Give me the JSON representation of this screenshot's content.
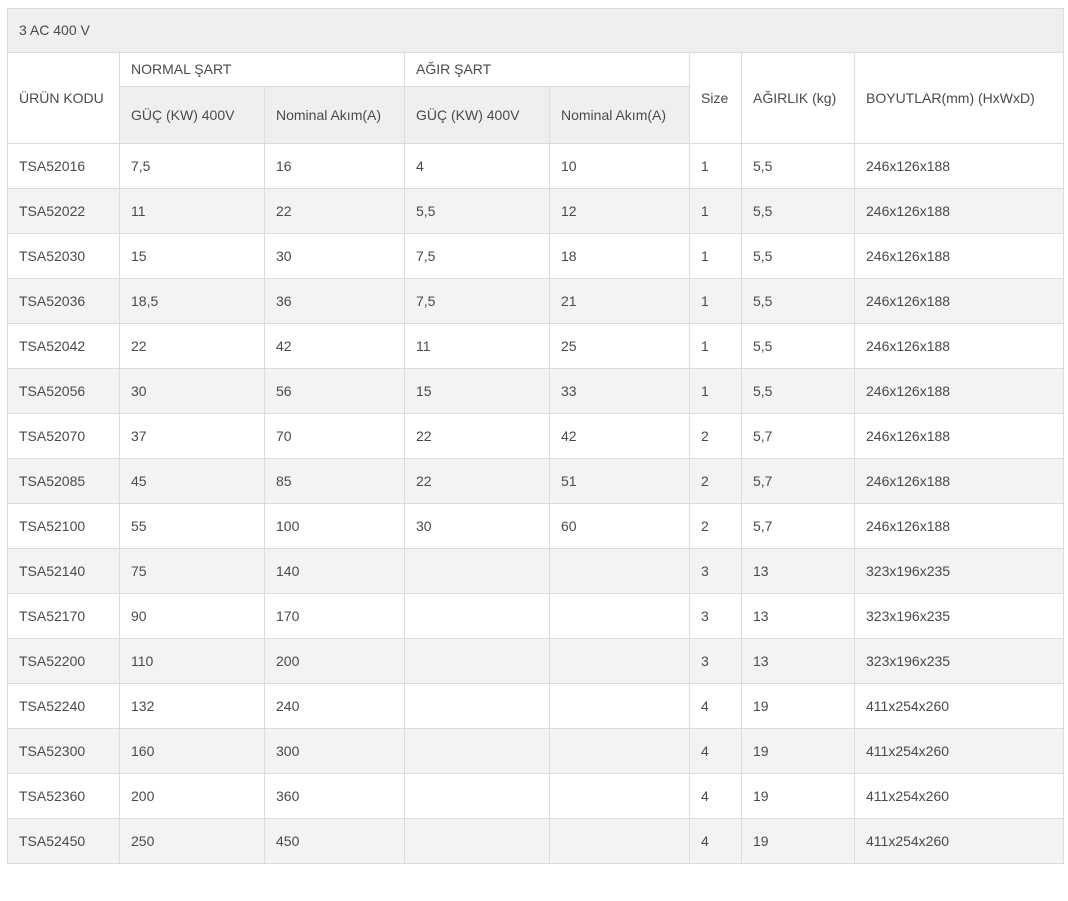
{
  "title": "3 AC 400 V",
  "headers": {
    "product_code": "ÜRÜN\nKODU",
    "normal": "NORMAL ŞART",
    "heavy": "AĞIR ŞART",
    "size": "Size",
    "weight": "AĞIRLIK\n(kg)",
    "dimensions": "BOYUTLAR(mm)\n(HxWxD)",
    "power": "GÜÇ     (KW)\n400V",
    "current": "Nominal\nAkım(A)"
  },
  "rows": [
    [
      "TSA52016",
      "7,5",
      "16",
      "4",
      "10",
      "1",
      "5,5",
      "246x126x188"
    ],
    [
      "TSA52022",
      "11",
      "22",
      "5,5",
      "12",
      "1",
      "5,5",
      "246x126x188"
    ],
    [
      "TSA52030",
      "15",
      "30",
      "7,5",
      "18",
      "1",
      "5,5",
      "246x126x188"
    ],
    [
      "TSA52036",
      "18,5",
      "36",
      "7,5",
      "21",
      "1",
      "5,5",
      "246x126x188"
    ],
    [
      "TSA52042",
      "22",
      "42",
      "11",
      "25",
      "1",
      "5,5",
      "246x126x188"
    ],
    [
      "TSA52056",
      "30",
      "56",
      "15",
      "33",
      "1",
      "5,5",
      "246x126x188"
    ],
    [
      "TSA52070",
      "37",
      "70",
      "22",
      "42",
      "2",
      "5,7",
      "246x126x188"
    ],
    [
      "TSA52085",
      "45",
      "85",
      "22",
      "51",
      "2",
      "5,7",
      "246x126x188"
    ],
    [
      "TSA52100",
      "55",
      "100",
      "30",
      "60",
      "2",
      "5,7",
      "246x126x188"
    ],
    [
      "TSA52140",
      "75",
      "140",
      "",
      "",
      "3",
      "13",
      "323x196x235"
    ],
    [
      "TSA52170",
      "90",
      "170",
      "",
      "",
      "3",
      "13",
      "323x196x235"
    ],
    [
      "TSA52200",
      "110",
      "200",
      "",
      "",
      "3",
      "13",
      "323x196x235"
    ],
    [
      "TSA52240",
      "132",
      "240",
      "",
      "",
      "4",
      "19",
      "411x254x260"
    ],
    [
      "TSA52300",
      "160",
      "300",
      "",
      "",
      "4",
      "19",
      "411x254x260"
    ],
    [
      "TSA52360",
      "200",
      "360",
      "",
      "",
      "4",
      "19",
      "411x254x260"
    ],
    [
      "TSA52450",
      "250",
      "450",
      "",
      "",
      "4",
      "19",
      "411x254x260"
    ]
  ]
}
